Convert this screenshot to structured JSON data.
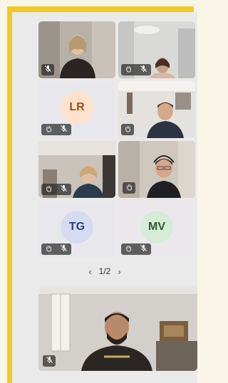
{
  "colors": {
    "frame": "#f5c924",
    "panel": "#ebeaea",
    "active_outline": "#5b5fc7"
  },
  "tiles": [
    {
      "name": "participant-tile-1",
      "kind": "video",
      "controls": [
        "mic-off-icon"
      ]
    },
    {
      "name": "participant-tile-2",
      "kind": "video",
      "controls": [
        "raise-hand-icon",
        "mic-off-icon"
      ]
    },
    {
      "name": "participant-tile-3",
      "kind": "avatar",
      "initials": "LR",
      "avatar_color": "#fde3cf",
      "initials_color": "#a54a16",
      "controls": [
        "raise-hand-icon",
        "mic-off-icon"
      ]
    },
    {
      "name": "participant-tile-4",
      "kind": "video",
      "controls": [
        "raise-hand-icon"
      ]
    },
    {
      "name": "participant-tile-5",
      "kind": "video",
      "controls": [
        "raise-hand-icon",
        "mic-off-icon"
      ]
    },
    {
      "name": "participant-tile-6",
      "kind": "video",
      "active_speaker": true,
      "controls": [
        "raise-hand-icon"
      ]
    },
    {
      "name": "participant-tile-7",
      "kind": "avatar",
      "initials": "TG",
      "avatar_color": "#d6dcf0",
      "initials_color": "#2c3f7a",
      "controls": [
        "raise-hand-icon",
        "mic-off-icon"
      ]
    },
    {
      "name": "participant-tile-8",
      "kind": "avatar",
      "initials": "MV",
      "avatar_color": "#d7ecd8",
      "initials_color": "#2b5a31",
      "controls": [
        "raise-hand-icon",
        "mic-off-icon"
      ]
    }
  ],
  "pager": {
    "prev": "‹",
    "label": "1/2",
    "next": "›"
  },
  "self_view": {
    "name": "self-view-tile",
    "controls": [
      "mic-off-icon"
    ]
  }
}
